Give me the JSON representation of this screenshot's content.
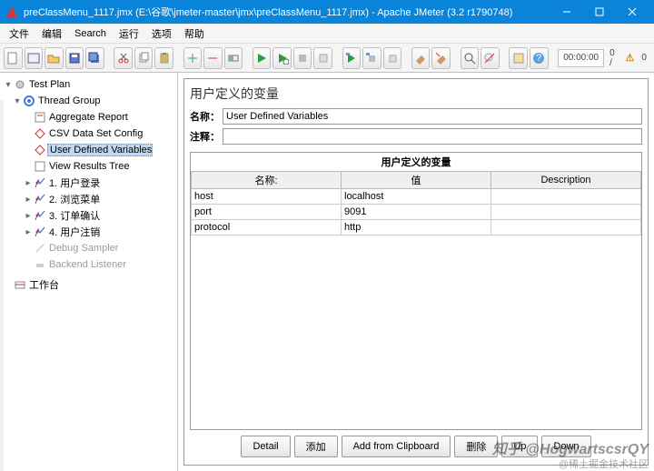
{
  "window": {
    "title": "preClassMenu_1117.jmx (E:\\谷歌\\jmeter-master\\jmx\\preClassMenu_1117.jmx) - Apache JMeter (3.2 r1790748)"
  },
  "menu": [
    "文件",
    "编辑",
    "Search",
    "运行",
    "选项",
    "帮助"
  ],
  "toolbar": {
    "timer": "00:00:00",
    "count": "0 /",
    "errors": "0"
  },
  "tree": {
    "root": "Test Plan",
    "threadGroup": "Thread Group",
    "items": [
      "Aggregate Report",
      "CSV Data Set Config",
      "User Defined Variables",
      "View Results Tree",
      "1. 用户登录",
      "2. 浏览菜单",
      "3. 订单确认",
      "4. 用户注销",
      "Debug Sampler",
      "Backend Listener"
    ],
    "workbench": "工作台"
  },
  "editor": {
    "heading": "用户定义的变量",
    "nameLabel": "名称：",
    "nameValue": "User Defined Variables",
    "commentLabel": "注释：",
    "commentValue": "",
    "tableTitle": "用户定义的变量",
    "cols": {
      "name": "名称:",
      "value": "值",
      "desc": "Description"
    },
    "rows": [
      {
        "name": "host",
        "value": "localhost",
        "desc": ""
      },
      {
        "name": "port",
        "value": "9091",
        "desc": ""
      },
      {
        "name": "protocol",
        "value": "http",
        "desc": ""
      }
    ],
    "buttons": [
      "Detail",
      "添加",
      "Add from Clipboard",
      "删除",
      "Up",
      "Down"
    ]
  },
  "watermark": {
    "line1": "知乎 @HogwartscsrQY",
    "line2": "@稀土掘金技术社区"
  }
}
